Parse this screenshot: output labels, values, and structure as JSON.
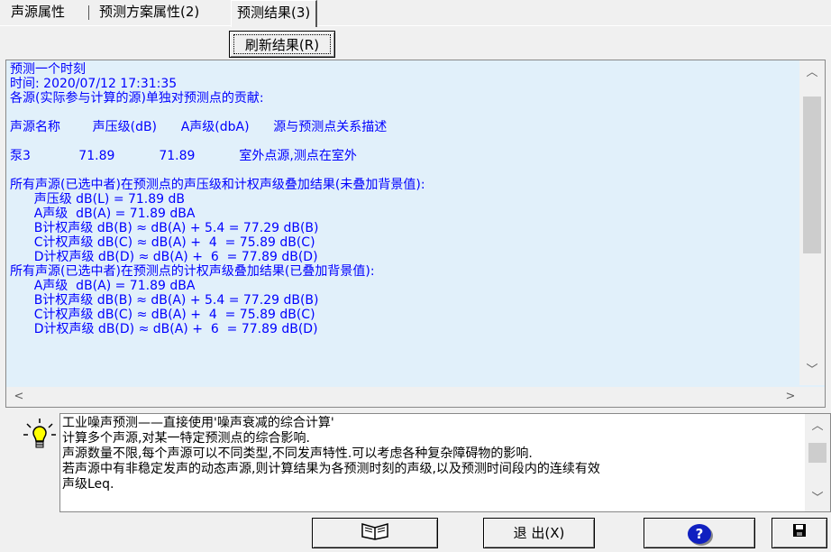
{
  "tabs": [
    "声源属性",
    "预测方案属性(2)",
    "预测结果(3)"
  ],
  "refresh_button": "刷新结果(R)",
  "results": {
    "lines": [
      "预测一个时刻",
      "时间: 2020/07/12 17:31:35",
      "各源(实际参与计算的源)单独对预测点的贡献:",
      "",
      "声源名称        声压级(dB)      A声级(dbA)      源与预测点关系描述",
      "",
      "泵3            71.89           71.89           室外点源,测点在室外",
      "",
      "所有声源(已选中者)在预测点的声压级和计权声级叠加结果(未叠加背景值):",
      "      声压级 dB(L) = 71.89 dB",
      "      A声级  dB(A) = 71.89 dBA",
      "      B计权声级 dB(B) ≈ dB(A) + 5.4 = 77.29 dB(B)",
      "      C计权声级 dB(C) ≈ dB(A) +  4  = 75.89 dB(C)",
      "      D计权声级 dB(D) ≈ dB(A) +  6  = 77.89 dB(D)",
      "所有声源(已选中者)在预测点的计权声级叠加结果(已叠加背景值):",
      "      A声级  dB(A) = 71.89 dBA",
      "      B计权声级 dB(B) ≈ dB(A) + 5.4 = 77.29 dB(B)",
      "      C计权声级 dB(C) ≈ dB(A) +  4  = 75.89 dB(C)",
      "      D计权声级 dB(D) ≈ dB(A) +  6  = 77.89 dB(D)"
    ]
  },
  "help": {
    "lines": [
      "        工业噪声预测——直接使用'噪声衰减的综合计算'",
      "        计算多个声源,对某一特定预测点的综合影响.",
      "        声源数量不限,每个声源可以不同类型,不同发声特性.可以考虑各种复杂障碍物的影响.",
      "        若声源中有非稳定发声的动态声源,则计算结果为各预测时刻的声级,以及预测时间段内的连续有效",
      "声级Leq."
    ]
  },
  "buttons": {
    "exit": "退 出(X)",
    "help_icon": "?"
  },
  "icons": {
    "book": "book-icon",
    "bulb": "lightbulb-icon",
    "save": "save-icon"
  },
  "colors": {
    "results_bg": "#e1f0fa",
    "results_text": "#0000ff"
  }
}
